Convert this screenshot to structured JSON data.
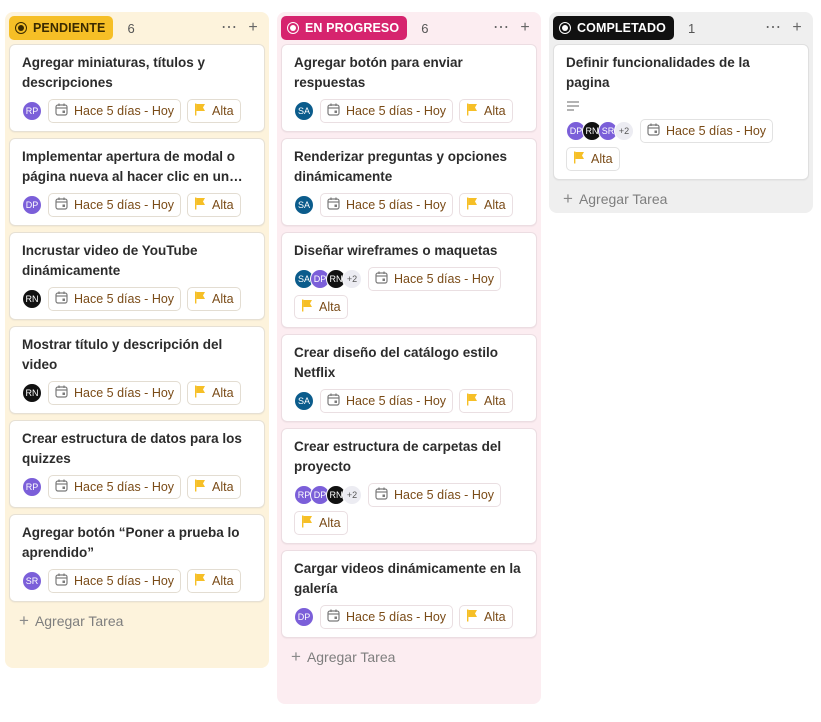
{
  "columns": [
    {
      "status": "PENDIENTE",
      "count": "6",
      "add_label": "Agregar Tarea",
      "cards": [
        {
          "title": "Agregar miniaturas, títulos y descripciones",
          "avatars": [
            {
              "initials": "RP",
              "color": "#7b5fd9"
            }
          ],
          "more": "",
          "date": "Hace 5 días - Hoy",
          "priority": "Alta",
          "has_description": false
        },
        {
          "title": "Implementar apertura de modal o página nueva al hacer clic en un video",
          "avatars": [
            {
              "initials": "DP",
              "color": "#7b5fd9"
            }
          ],
          "more": "",
          "date": "Hace 5 días - Hoy",
          "priority": "Alta",
          "has_description": false
        },
        {
          "title": "Incrustar video de YouTube dinámicamente",
          "avatars": [
            {
              "initials": "RN",
              "color": "#111111"
            }
          ],
          "more": "",
          "date": "Hace 5 días - Hoy",
          "priority": "Alta",
          "has_description": false
        },
        {
          "title": "Mostrar título y descripción del video",
          "avatars": [
            {
              "initials": "RN",
              "color": "#111111"
            }
          ],
          "more": "",
          "date": "Hace 5 días - Hoy",
          "priority": "Alta",
          "has_description": false
        },
        {
          "title": "Crear estructura de datos para los quizzes",
          "avatars": [
            {
              "initials": "RP",
              "color": "#7b5fd9"
            }
          ],
          "more": "",
          "date": "Hace 5 días - Hoy",
          "priority": "Alta",
          "has_description": false
        },
        {
          "title": "Agregar botón “Poner a prueba lo aprendido”",
          "avatars": [
            {
              "initials": "SR",
              "color": "#7b5fd9"
            }
          ],
          "more": "",
          "date": "Hace 5 días - Hoy",
          "priority": "Alta",
          "has_description": false
        }
      ]
    },
    {
      "status": "EN PROGRESO",
      "count": "6",
      "add_label": "Agregar Tarea",
      "cards": [
        {
          "title": "Agregar botón para enviar respuestas",
          "avatars": [
            {
              "initials": "SA",
              "color": "#0b5c8c"
            }
          ],
          "more": "",
          "date": "Hace 5 días - Hoy",
          "priority": "Alta",
          "has_description": false
        },
        {
          "title": "Renderizar preguntas y opciones dinámicamente",
          "avatars": [
            {
              "initials": "SA",
              "color": "#0b5c8c"
            }
          ],
          "more": "",
          "date": "Hace 5 días - Hoy",
          "priority": "Alta",
          "has_description": false
        },
        {
          "title": "Diseñar wireframes o maquetas",
          "avatars": [
            {
              "initials": "SA",
              "color": "#0b5c8c"
            },
            {
              "initials": "DP",
              "color": "#7b5fd9"
            },
            {
              "initials": "RN",
              "color": "#111111"
            }
          ],
          "more": "+2",
          "date": "Hace 5 días - Hoy",
          "priority": "Alta",
          "has_description": false
        },
        {
          "title": "Crear diseño del catálogo estilo Netflix",
          "avatars": [
            {
              "initials": "SA",
              "color": "#0b5c8c"
            }
          ],
          "more": "",
          "date": "Hace 5 días - Hoy",
          "priority": "Alta",
          "has_description": false
        },
        {
          "title": "Crear estructura de carpetas del proyecto",
          "avatars": [
            {
              "initials": "RP",
              "color": "#7b5fd9"
            },
            {
              "initials": "DP",
              "color": "#7b5fd9"
            },
            {
              "initials": "RN",
              "color": "#111111"
            }
          ],
          "more": "+2",
          "date": "Hace 5 días - Hoy",
          "priority": "Alta",
          "has_description": false
        },
        {
          "title": "Cargar videos dinámicamente en la galería",
          "avatars": [
            {
              "initials": "DP",
              "color": "#7b5fd9"
            }
          ],
          "more": "",
          "date": "Hace 5 días - Hoy",
          "priority": "Alta",
          "has_description": false
        }
      ]
    },
    {
      "status": "COMPLETADO",
      "count": "1",
      "add_label": "Agregar Tarea",
      "cards": [
        {
          "title": "Definir funcionalidades de la pagina",
          "avatars": [
            {
              "initials": "DP",
              "color": "#7b5fd9"
            },
            {
              "initials": "RN",
              "color": "#111111"
            },
            {
              "initials": "SR",
              "color": "#7b5fd9"
            }
          ],
          "more": "+2",
          "date": "Hace 5 días - Hoy",
          "priority": "Alta",
          "has_description": true
        }
      ]
    }
  ],
  "icons": {
    "menu": "more-horizontal-icon",
    "add": "plus-icon",
    "calendar": "calendar-icon",
    "flag": "flag-icon",
    "description": "text-lines-icon"
  },
  "colors": {
    "pendiente": "#f6bf26",
    "en_progreso": "#d6246e",
    "completado": "#111111",
    "priority_flag": "#f6bf26"
  }
}
